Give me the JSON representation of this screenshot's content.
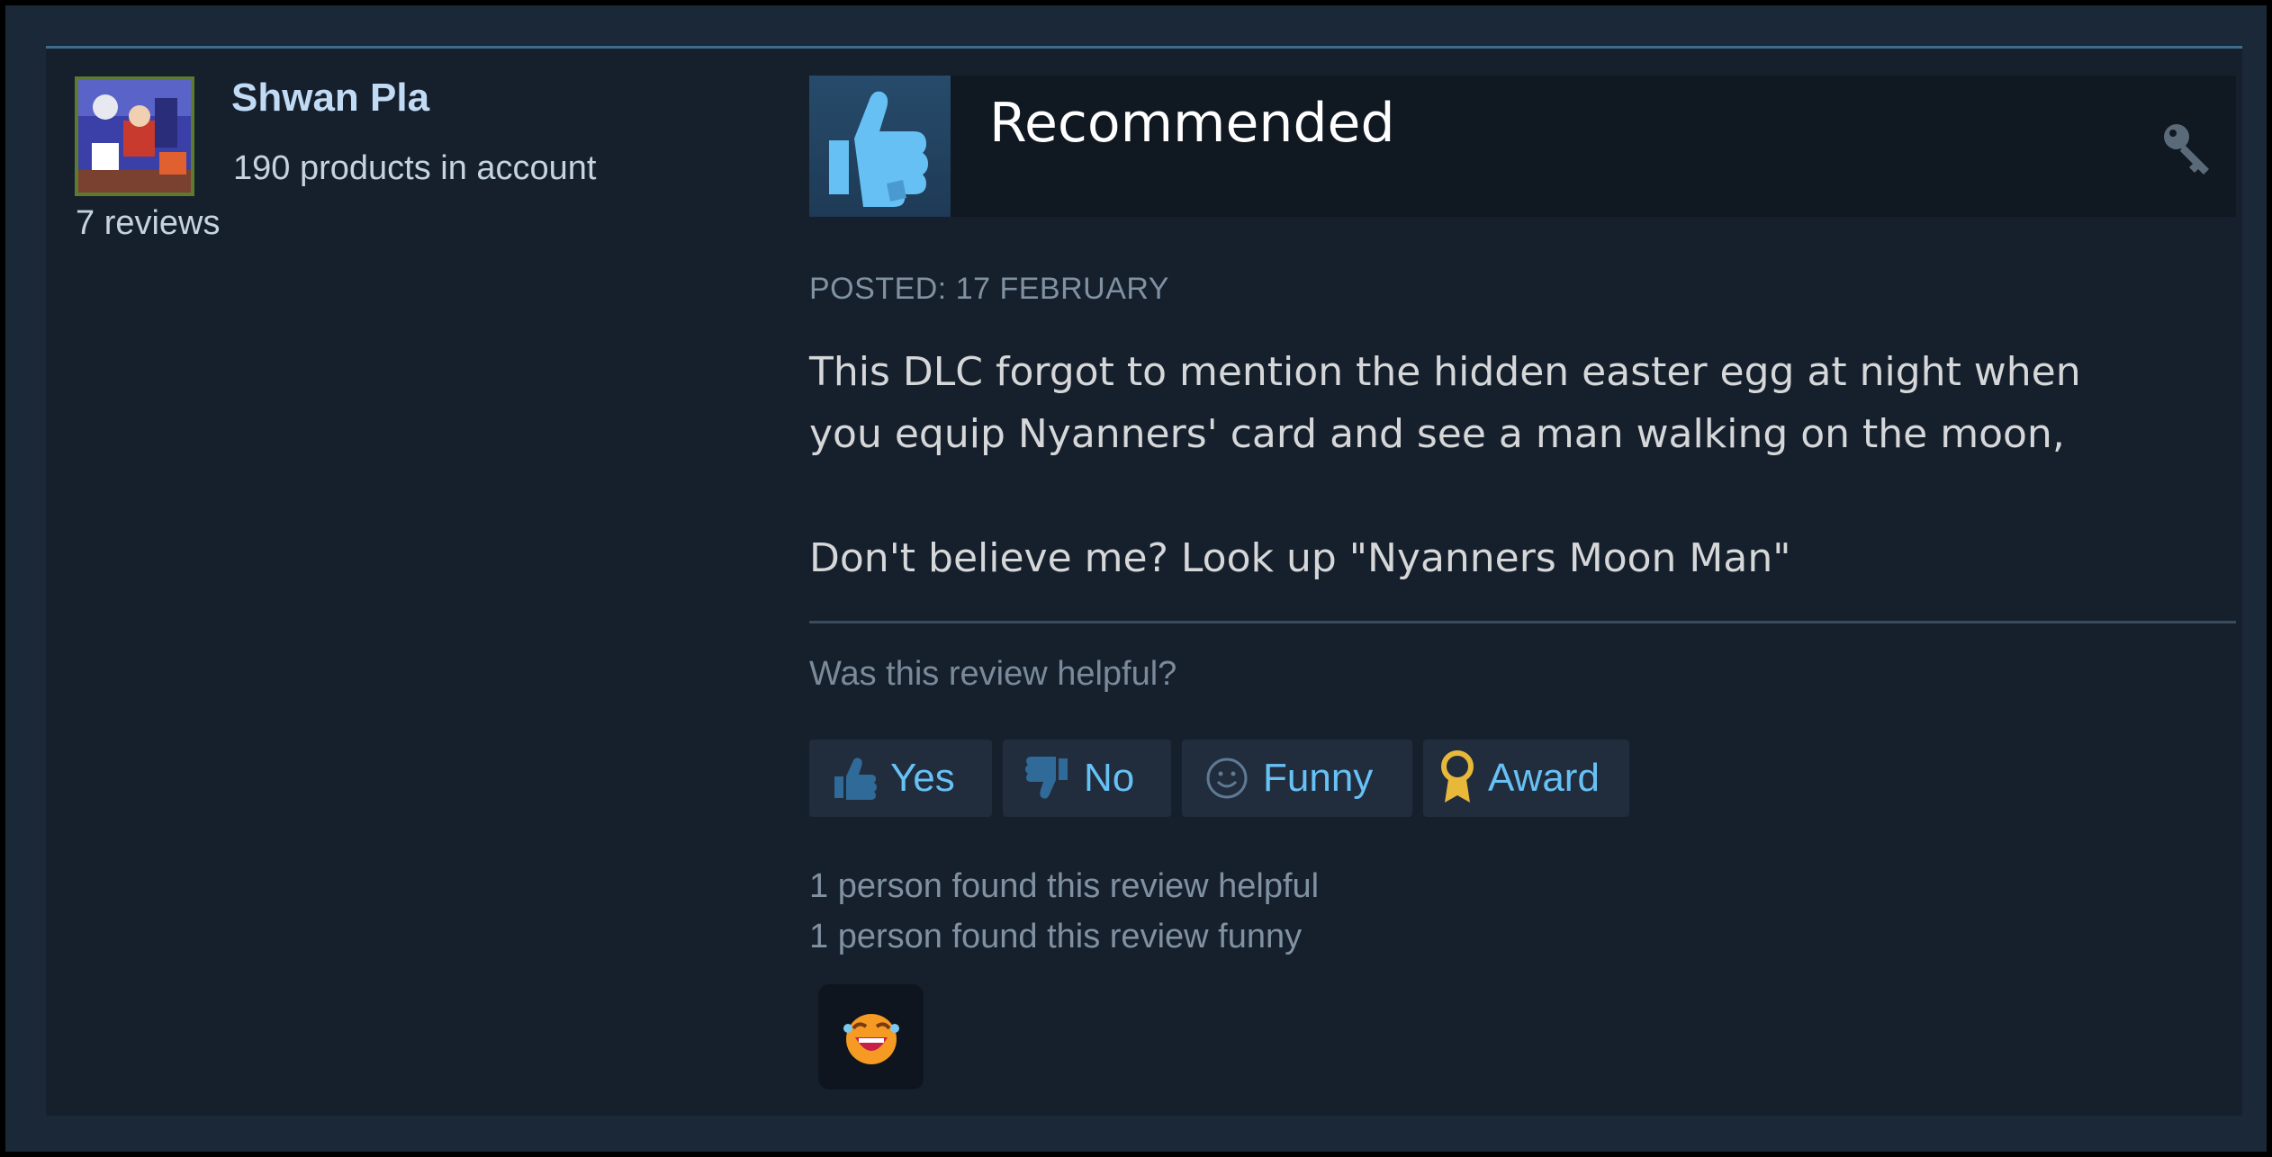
{
  "reviewer": {
    "name": "Shwan Pla",
    "products": "190 products in account",
    "reviews": "7 reviews"
  },
  "review": {
    "verdict": "Recommended",
    "posted": "POSTED: 17 FEBRUARY",
    "body": "This DLC forgot to mention the hidden easter egg at night when\nyou equip Nyanners' card and see a man walking on the moon,\n\nDon't believe me? Look up \"Nyanners Moon Man\""
  },
  "feedback": {
    "question": "Was this review helpful?",
    "yes": "Yes",
    "no": "No",
    "funny": "Funny",
    "award": "Award",
    "helpful_count": "1 person found this review helpful",
    "funny_count": "1 person found this review funny"
  },
  "icons": {
    "verdict": "thumbs-up-icon",
    "key": "key-icon",
    "award_received": "laughing-face-icon"
  },
  "colors": {
    "accent": "#67c1f5",
    "card_bg": "#16202d",
    "thumb_bg": "#274b6b"
  }
}
